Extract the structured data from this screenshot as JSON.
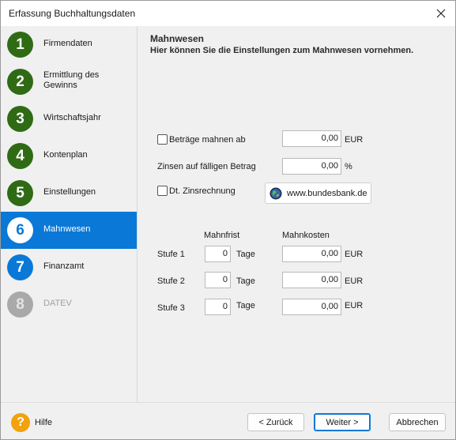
{
  "window": {
    "title": "Erfassung Buchhaltungsdaten"
  },
  "sidebar": {
    "steps": [
      {
        "number": "1",
        "label": "Firmendaten"
      },
      {
        "number": "2",
        "label_line1": "Ermittlung des",
        "label_line2": "Gewinns"
      },
      {
        "number": "3",
        "label": "Wirtschaftsjahr"
      },
      {
        "number": "4",
        "label": "Kontenplan"
      },
      {
        "number": "5",
        "label": "Einstellungen"
      },
      {
        "number": "6",
        "label": "Mahnwesen"
      },
      {
        "number": "7",
        "label": "Finanzamt"
      },
      {
        "number": "8",
        "label": "DATEV"
      }
    ]
  },
  "main": {
    "heading": "Mahnwesen",
    "subheading": "Hier können Sie die Einstellungen zum Mahnwesen vornehmen.",
    "betraege": {
      "label": "Beträge mahnen ab",
      "value": "0,00",
      "unit": "EUR",
      "checked": false
    },
    "zinsen": {
      "label": "Zinsen auf fälligen Betrag",
      "value": "0,00",
      "unit": "%"
    },
    "zinsrechnung": {
      "label": "Dt. Zinsrechnung",
      "checked": false
    },
    "bundesbank_button": "www.bundesbank.de",
    "columns": {
      "mahnfrist": "Mahnfrist",
      "mahnkosten": "Mahnkosten"
    },
    "stufen": [
      {
        "label": "Stufe 1",
        "frist": "0",
        "frist_unit": "Tage",
        "kosten": "0,00",
        "kosten_unit": "EUR"
      },
      {
        "label": "Stufe 2",
        "frist": "0",
        "frist_unit": "Tage",
        "kosten": "0,00",
        "kosten_unit": "EUR"
      },
      {
        "label": "Stufe 3",
        "frist": "0",
        "frist_unit": "Tage",
        "kosten": "0,00",
        "kosten_unit": "EUR"
      }
    ]
  },
  "footer": {
    "help_icon_glyph": "?",
    "help_label": "Hilfe",
    "back_label": "< Zurück",
    "next_label": "Weiter >",
    "cancel_label": "Abbrechen"
  },
  "colors": {
    "accent": "#0a78d7",
    "step_done": "#2f6b15",
    "step_disabled": "#a9a9a9",
    "help": "#f2a20c"
  },
  "active_step": "6"
}
